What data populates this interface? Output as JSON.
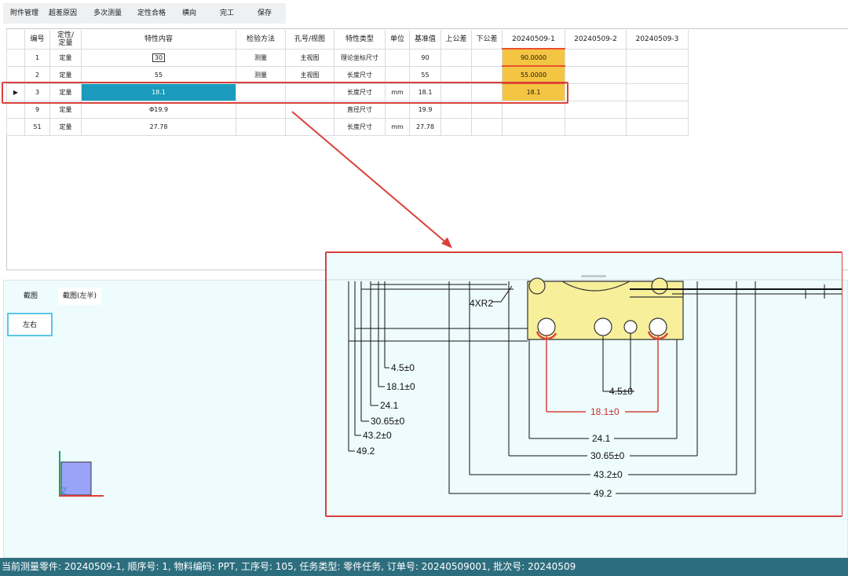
{
  "toolbar": {
    "items": [
      "附件管理",
      "超差原因",
      "多次测量",
      "定性合格",
      "横向",
      "完工",
      "保存"
    ]
  },
  "grid": {
    "headers": [
      "",
      "编号",
      "定性/\n定量",
      "特性内容",
      "检验方法",
      "孔号/视图",
      "特性类型",
      "单位",
      "基准值",
      "上公差",
      "下公差",
      "20240509-1",
      "20240509-2",
      "20240509-3"
    ],
    "rows": [
      {
        "indicator": "",
        "no": "1",
        "type": "定量",
        "content": "30",
        "method": "测量",
        "view": "主视图",
        "char_type": "理论坐标尺寸",
        "unit": "",
        "base": "90",
        "upper": "",
        "lower": "",
        "m1": "90.0000",
        "m2": "",
        "m3": ""
      },
      {
        "indicator": "",
        "no": "2",
        "type": "定量",
        "content": "55",
        "method": "测量",
        "view": "主视图",
        "char_type": "长度尺寸",
        "unit": "",
        "base": "55",
        "upper": "",
        "lower": "",
        "m1": "55.0000",
        "m2": "",
        "m3": ""
      },
      {
        "indicator": "▶",
        "no": "3",
        "type": "定量",
        "content": "18.1",
        "method": "",
        "view": "",
        "char_type": "长度尺寸",
        "unit": "mm",
        "base": "18.1",
        "upper": "",
        "lower": "",
        "m1": "18.1",
        "m2": "",
        "m3": ""
      },
      {
        "indicator": "",
        "no": "9",
        "type": "定量",
        "content": "Φ19.9",
        "method": "",
        "view": "",
        "char_type": "直径尺寸",
        "unit": "",
        "base": "19.9",
        "upper": "",
        "lower": "",
        "m1": "",
        "m2": "",
        "m3": ""
      },
      {
        "indicator": "",
        "no": "51",
        "type": "定量",
        "content": "27.78",
        "method": "",
        "view": "",
        "char_type": "长度尺寸",
        "unit": "mm",
        "base": "27.78",
        "upper": "",
        "lower": "",
        "m1": "",
        "m2": "",
        "m3": ""
      }
    ]
  },
  "viewer": {
    "tab_screenshot": "截图",
    "tab_screenshot_left": "截图(左半)",
    "tab_left_right": "左右",
    "axis_label": "Z"
  },
  "drawing": {
    "radius_note": "4XR2",
    "left_dims": [
      "4.5±0",
      "18.1±0",
      "24.1",
      "30.65±0",
      "43.2±0",
      "49.2"
    ],
    "bottom_dims": [
      "4.5±0",
      "18.1±0",
      "24.1",
      "30.65±0",
      "43.2±0",
      "49.2"
    ]
  },
  "colors": {
    "selection": "#1a9bbd",
    "measured": "#f4c542",
    "highlight": "#d8413a",
    "status_bar": "#2d6e7e",
    "viewer_bg": "#eefcfd",
    "part_fill": "#f8ef9a"
  },
  "status": {
    "text": "当前测量零件: 20240509-1, 顺序号: 1, 物料编码: PPT, 工序号: 105, 任务类型: 零件任务, 订单号: 20240509001, 批次号: 20240509"
  }
}
